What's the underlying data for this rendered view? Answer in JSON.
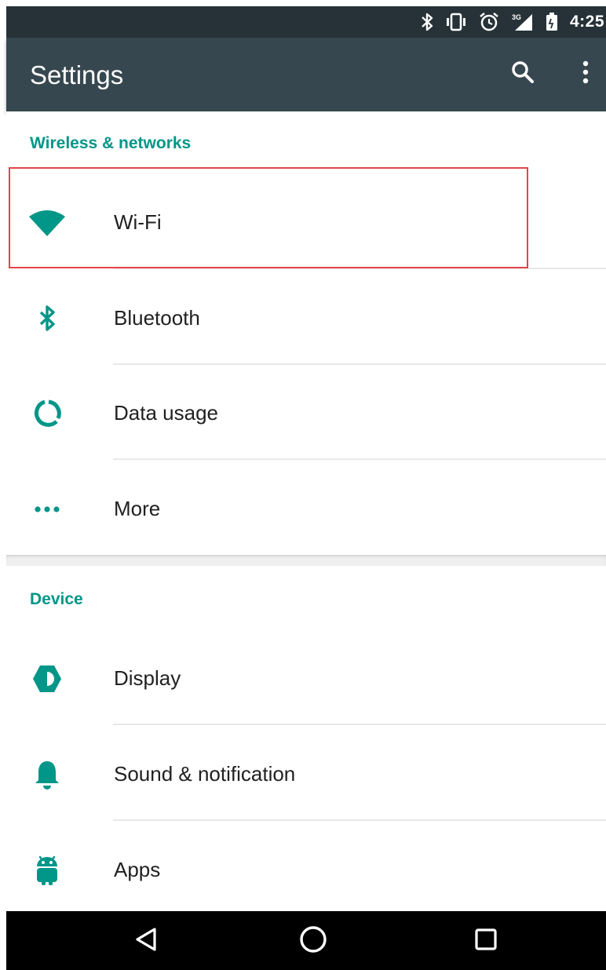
{
  "status_bar": {
    "time": "4:25",
    "icons": [
      "bluetooth-icon",
      "vibrate-icon",
      "alarm-icon",
      "signal-3g-icon",
      "battery-icon"
    ],
    "network_type": "3G"
  },
  "app_bar": {
    "title": "Settings",
    "actions": [
      "search-icon",
      "more-vert-icon"
    ]
  },
  "sections": [
    {
      "header": "Wireless & networks",
      "items": [
        {
          "label": "Wi-Fi",
          "icon": "wifi-icon",
          "highlighted": true
        },
        {
          "label": "Bluetooth",
          "icon": "bluetooth-icon"
        },
        {
          "label": "Data usage",
          "icon": "data-usage-icon"
        },
        {
          "label": "More",
          "icon": "more-horiz-icon"
        }
      ]
    },
    {
      "header": "Device",
      "items": [
        {
          "label": "Display",
          "icon": "brightness-icon"
        },
        {
          "label": "Sound & notification",
          "icon": "bell-icon"
        },
        {
          "label": "Apps",
          "icon": "android-icon"
        }
      ]
    }
  ],
  "nav_bar": {
    "buttons": [
      "back-icon",
      "home-icon",
      "recents-icon"
    ]
  },
  "colors": {
    "accent": "#009688",
    "app_bar": "#37474f",
    "status_bar": "#263238",
    "highlight_border": "#e5454a",
    "nav_bar": "#000000"
  }
}
